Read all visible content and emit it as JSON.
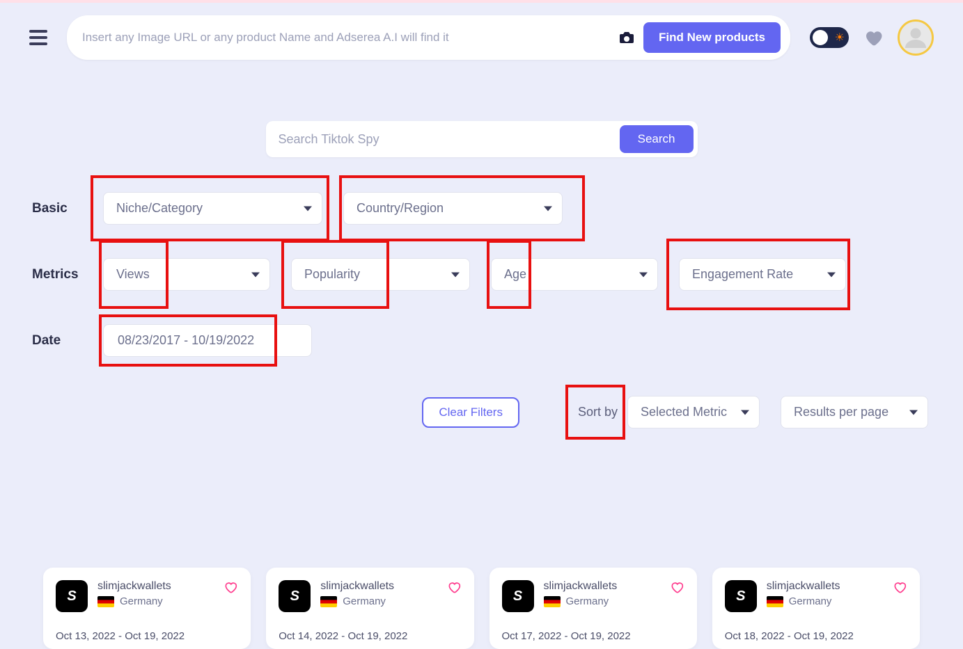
{
  "header": {
    "search_placeholder": "Insert any Image URL or any product Name and Adserea A.I will find it",
    "find_btn": "Find New products"
  },
  "spy": {
    "placeholder": "Search Tiktok Spy",
    "btn": "Search"
  },
  "filters": {
    "basic_label": "Basic",
    "metrics_label": "Metrics",
    "date_label": "Date",
    "niche": "Niche/Category",
    "country": "Country/Region",
    "views": "Views",
    "popularity": "Popularity",
    "age": "Age",
    "engagement": "Engagement Rate",
    "date_range": "08/23/2017 - 10/19/2022"
  },
  "actions": {
    "clear": "Clear Filters",
    "sort_label": "Sort by",
    "sort_value": "Selected Metric",
    "rpp": "Results per page"
  },
  "cards": [
    {
      "name": "slimjackwallets",
      "country": "Germany",
      "date": "Oct 13, 2022 - Oct 19, 2022"
    },
    {
      "name": "slimjackwallets",
      "country": "Germany",
      "date": "Oct 14, 2022 - Oct 19, 2022"
    },
    {
      "name": "slimjackwallets",
      "country": "Germany",
      "date": "Oct 17, 2022 - Oct 19, 2022"
    },
    {
      "name": "slimjackwallets",
      "country": "Germany",
      "date": "Oct 18, 2022 - Oct 19, 2022"
    }
  ]
}
